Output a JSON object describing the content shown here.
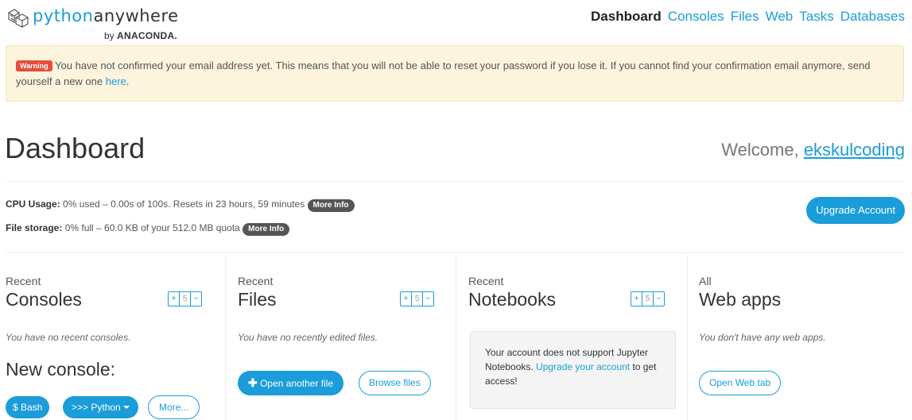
{
  "header": {
    "logo_python": "python",
    "logo_anywhere": "anywhere",
    "logo_by": "by",
    "logo_anaconda": "ANACONDA.",
    "nav": [
      {
        "label": "Dashboard",
        "active": true
      },
      {
        "label": "Consoles",
        "active": false
      },
      {
        "label": "Files",
        "active": false
      },
      {
        "label": "Web",
        "active": false
      },
      {
        "label": "Tasks",
        "active": false
      },
      {
        "label": "Databases",
        "active": false
      }
    ]
  },
  "alert": {
    "badge": "Warning",
    "text": " You have not confirmed your email address yet. This means that you will not be able to reset your password if you lose it. If you cannot find your confirmation email anymore, send yourself a new one ",
    "link": "here",
    "end": "."
  },
  "page": {
    "title": "Dashboard",
    "welcome_prefix": "Welcome, ",
    "username": "ekskulcoding"
  },
  "usage": {
    "cpu_label": "CPU Usage:",
    "cpu_text": " 0% used – 0.00s of 100s. Resets in 23 hours, 59 minutes ",
    "storage_label": "File storage:",
    "storage_text": " 0% full – 60.0 KB of your 512.0 MB quota ",
    "more_info": "More Info",
    "upgrade": "Upgrade Account"
  },
  "columns": {
    "consoles": {
      "sub": "Recent",
      "title": "Consoles",
      "empty": "You have no recent consoles.",
      "pager": [
        "+",
        "5",
        "−"
      ]
    },
    "files": {
      "sub": "Recent",
      "title": "Files",
      "empty": "You have no recently edited files.",
      "pager": [
        "+",
        "5",
        "−"
      ]
    },
    "notebooks": {
      "sub": "Recent",
      "title": "Notebooks",
      "pager": [
        "+",
        "5",
        "−"
      ]
    },
    "webapps": {
      "sub": "All",
      "title": "Web apps",
      "empty": "You don't have any web apps."
    }
  },
  "new_console": {
    "label": "New console:",
    "bash": "$ Bash",
    "python": ">>> Python",
    "more": "More..."
  },
  "files_actions": {
    "open": "Open another file",
    "browse": "Browse files"
  },
  "notebooks_msg": {
    "text1": "Your account does not support Jupyter Notebooks. ",
    "link": "Upgrade your account",
    "text2": " to get access!"
  },
  "webapps_action": {
    "open": "Open Web tab"
  },
  "colors": {
    "accent": "#1a9dd9",
    "warning_bg": "#fcf4dd",
    "danger": "#e84c3d"
  }
}
